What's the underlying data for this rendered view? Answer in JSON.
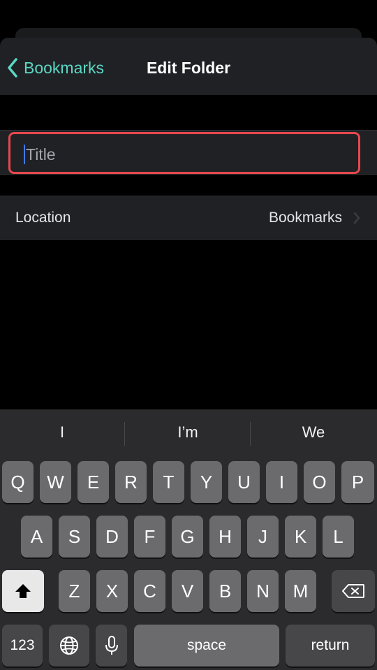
{
  "navbar": {
    "back_label": "Bookmarks",
    "title": "Edit Folder"
  },
  "form": {
    "title_placeholder": "Title",
    "title_value": "",
    "location_label": "Location",
    "location_value": "Bookmarks"
  },
  "keyboard": {
    "suggestions": [
      "I",
      "I’m",
      "We"
    ],
    "row1": [
      "Q",
      "W",
      "E",
      "R",
      "T",
      "Y",
      "U",
      "I",
      "O",
      "P"
    ],
    "row2": [
      "A",
      "S",
      "D",
      "F",
      "G",
      "H",
      "J",
      "K",
      "L"
    ],
    "row3": [
      "Z",
      "X",
      "C",
      "V",
      "B",
      "N",
      "M"
    ],
    "numbers_label": "123",
    "space_label": "space",
    "return_label": "return"
  },
  "colors": {
    "accent": "#5cd7c4",
    "highlight_border": "#e5484d",
    "caret": "#3d7bff"
  }
}
